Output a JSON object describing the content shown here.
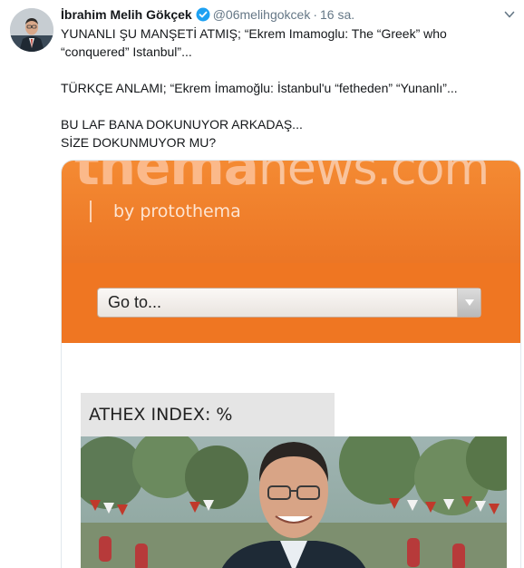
{
  "tweet": {
    "display_name": "İbrahim Melih Gökçek",
    "handle": "@06melihgokcek",
    "separator": "·",
    "time": "16 sa.",
    "text_lines": [
      "YUNANLI ŞU MANŞETİ ATMIŞ; “Ekrem Imamoglu: The “Greek” who “conquered” Istanbul”...",
      "TÜRKÇE ANLAMI; “Ekrem İmamoğlu: İstanbul'u “fetheden” “Yunanlı”...",
      "BU LAF BANA DOKUNUYOR ARKADAŞ...",
      "SİZE DOKUNMUYOR MU?"
    ]
  },
  "card": {
    "logo_main": "thema",
    "logo_suffix": "news.com",
    "by_line": "by protothema",
    "nav_select": "Go to...",
    "index_label": "ATHEX INDEX: %"
  },
  "icons": {
    "verified": "verified-badge-icon",
    "caret": "chevron-down-icon",
    "dropdown_arrow": "triangle-down-icon"
  },
  "colors": {
    "verified_blue": "#1da1f2",
    "thema_orange": "#ef7622",
    "secondary_text": "#657786"
  }
}
